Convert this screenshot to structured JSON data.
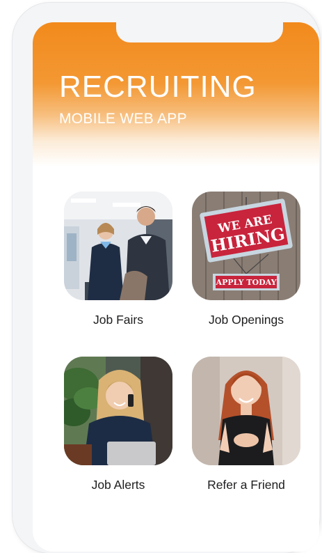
{
  "header": {
    "title": "RECRUITING",
    "subtitle": "MOBILE WEB APP"
  },
  "tiles": [
    {
      "label": "Job Fairs",
      "image": "job-fair-photo"
    },
    {
      "label": "Job Openings",
      "image": "we-are-hiring-sign",
      "sign_line1": "WE ARE",
      "sign_line2": "HIRING",
      "sign_button": "APPLY TODAY"
    },
    {
      "label": "Job Alerts",
      "image": "woman-on-phone-photo"
    },
    {
      "label": "Refer a Friend",
      "image": "smiling-woman-photo"
    }
  ],
  "colors": {
    "brand_orange": "#f28a1c",
    "sign_red": "#c8243c",
    "label_text": "#1d1d1f"
  }
}
